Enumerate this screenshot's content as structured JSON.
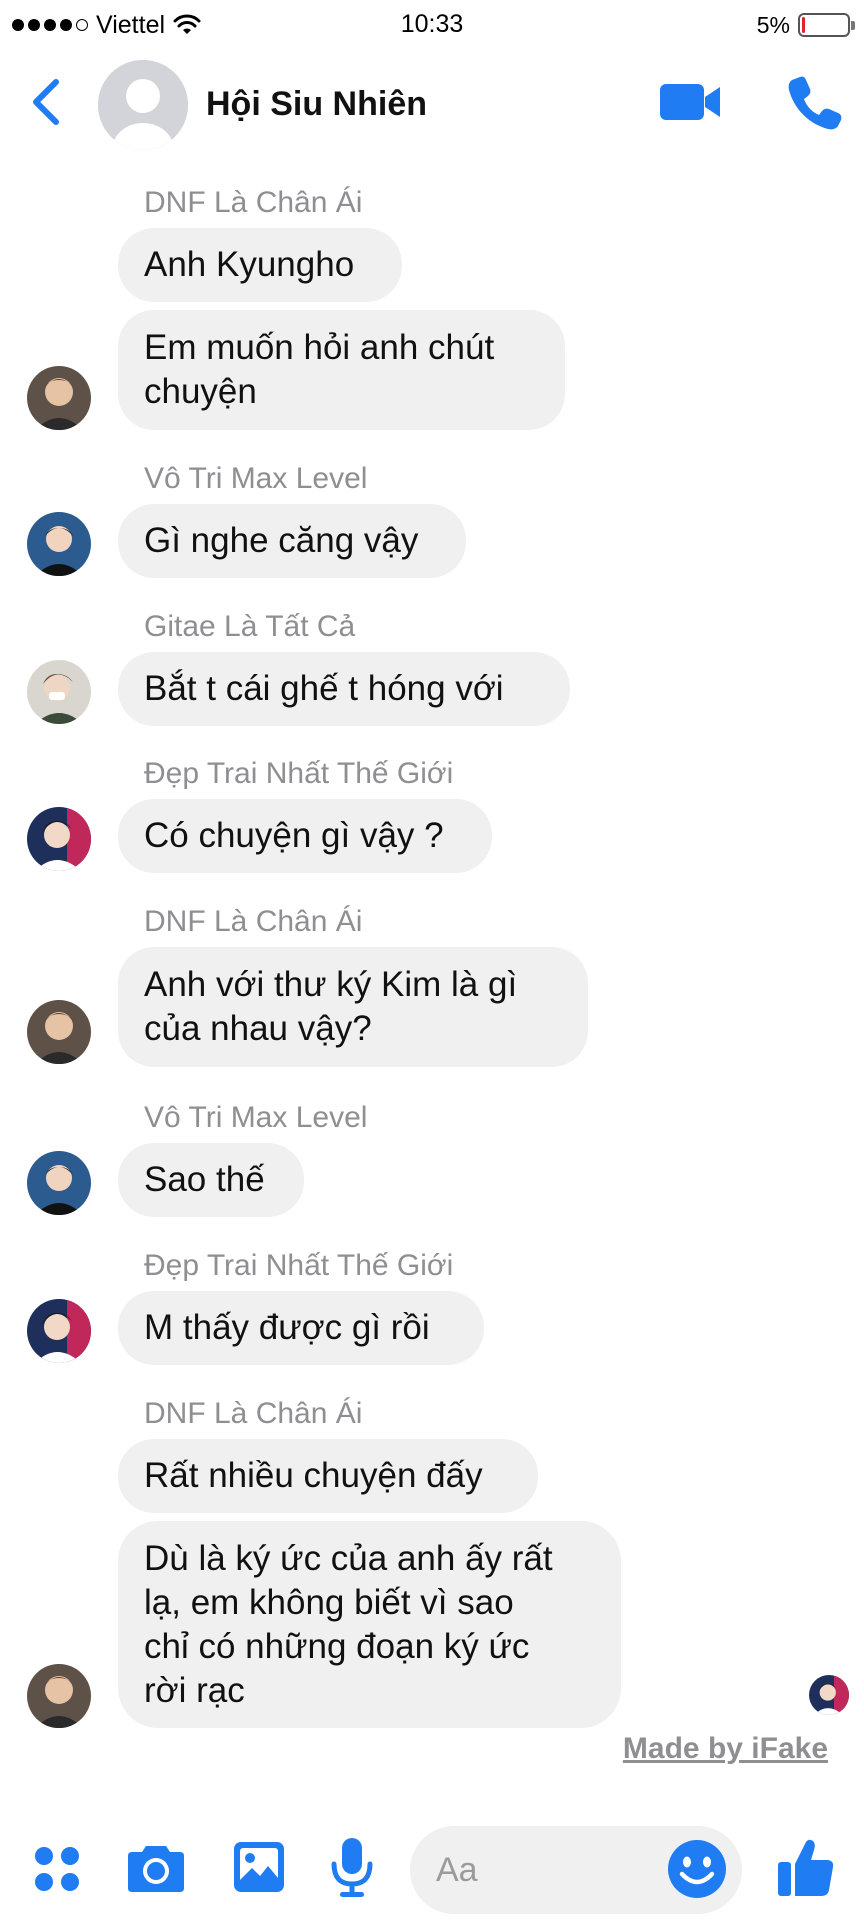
{
  "status_bar": {
    "carrier": "Viettel",
    "time": "10:33",
    "battery_percent": "5%",
    "battery_level": 0.05,
    "battery_color": "#e0242b",
    "signal_bars_filled": 4,
    "signal_bars_total": 5,
    "wifi_icon": "wifi-icon"
  },
  "header": {
    "title": "Hội Siu Nhiên",
    "back_icon": "chevron-left-icon",
    "avatar_icon": "group-avatar-placeholder",
    "video_icon": "video-camera-icon",
    "call_icon": "phone-icon",
    "accent_color": "#1f7cf2"
  },
  "messages": [
    {
      "sender": "DNF Là Chân Ái",
      "bubbles": [
        "Anh Kyungho",
        "Em muốn hỏi anh chút chuyện"
      ]
    },
    {
      "sender": "Vô Tri Max Level",
      "bubbles": [
        "Gì nghe căng vậy"
      ]
    },
    {
      "sender": "Gitae Là Tất Cả",
      "bubbles": [
        "Bắt t cái ghế t hóng với"
      ]
    },
    {
      "sender": "Đẹp Trai Nhất Thế Giới",
      "bubbles": [
        "Có chuyện gì vậy ?"
      ]
    },
    {
      "sender": "DNF Là Chân Ái",
      "bubbles": [
        "Anh với thư ký Kim là gì của nhau vậy?"
      ]
    },
    {
      "sender": "Vô Tri Max Level",
      "bubbles": [
        "Sao thế"
      ]
    },
    {
      "sender": "Đẹp Trai Nhất Thế Giới",
      "bubbles": [
        "M thấy được gì rồi"
      ]
    },
    {
      "sender": "DNF Là Chân Ái",
      "bubbles": [
        "Rất nhiều chuyện đấy",
        "Dù là ký ức của anh ấy rất lạ, em không biết vì sao chỉ có những đoạn ký ức rời rạc"
      ]
    }
  ],
  "bubble_texts": {
    "b1": "Anh Kyungho",
    "b2": "Em muốn hỏi anh chút\nchuyện",
    "b3": "Gì nghe căng vậy",
    "b4": "Bắt t cái ghế t hóng với",
    "b5": "Có chuyện gì vậy ?",
    "b6": "Anh với thư ký Kim là gì\ncủa nhau vậy?",
    "b7": "Sao thế",
    "b8": "M thấy được gì rồi",
    "b9": "Rất nhiều chuyện đấy",
    "b10": "Dù là ký ức của anh ấy rất\nlạ, em không biết vì sao\nchỉ có những đoạn ký ức\nrời rạc"
  },
  "sender_names": {
    "s1": "DNF Là Chân Ái",
    "s2": "Vô Tri Max Level",
    "s3": "Gitae Là Tất Cả",
    "s4": "Đẹp Trai Nhất Thế Giới",
    "s5": "DNF Là Chân Ái",
    "s6": "Vô Tri Max Level",
    "s7": "Đẹp Trai Nhất Thế Giới",
    "s8": "DNF Là Chân Ái"
  },
  "watermark": "Made by iFake",
  "composer": {
    "placeholder": "Aa",
    "more_icon": "four-dots-icon",
    "camera_icon": "camera-icon",
    "photo_icon": "photo-icon",
    "mic_icon": "microphone-icon",
    "emoji_icon": "smiley-icon",
    "like_icon": "thumbs-up-icon"
  }
}
